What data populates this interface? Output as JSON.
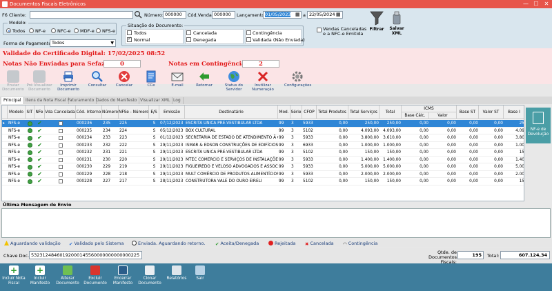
{
  "window": {
    "title": "Documentos Fiscais Eletrônicos",
    "minimize": "—",
    "maximize": "☐",
    "close": "✕"
  },
  "filters": {
    "f6_label": "F6",
    "cliente_label": "Cliente:",
    "cliente_value": "",
    "numero_label": "Número:",
    "numero_value": "000000",
    "cod_venda_label": "Cód.Venda:",
    "cod_venda_value": "000000",
    "lancamento_label": "Lançamento:",
    "date_from": "01/05/2023",
    "date_sep": "a",
    "date_to": "22/05/2024",
    "modelo_title": "Modelo:",
    "modelo_options": [
      "Todos",
      "NF-e",
      "NFC-e",
      "MDF-e",
      "NFS-e"
    ],
    "modelo_selected": "Todos",
    "forma_pagamento_label": "Forma de Pagamento:",
    "forma_pagamento_value": "Todos",
    "situacao_title": "Situação do Documento:",
    "situacao_options": [
      "Todos",
      "Normal",
      "Cancelada",
      "Denegada",
      "Contingência",
      "Validada (Não Enviada)"
    ],
    "vendas_canceladas_label": "Vendas Canceladas e a NFC-e Emitida",
    "filtrar_label": "Filtrar",
    "salvar_xml_label": "Salvar XML"
  },
  "status": {
    "validade_label": "Validade do Certificado Digital: 17/02/2025 08:52",
    "nao_enviadas_label": "Notas Não Enviadas para Sefaz:",
    "nao_enviadas_count": "0",
    "contingencia_label": "Notas em Contingência:",
    "contingencia_count": "2"
  },
  "toolbar": [
    {
      "label": "Enviar Documento",
      "icon": "send-document-icon",
      "disabled": true
    },
    {
      "label": "Pré Visualizar Documento",
      "icon": "preview-document-icon",
      "disabled": true
    },
    {
      "label": "Imprimir Documento",
      "icon": "printer-icon",
      "disabled": false
    },
    {
      "label": "Consultar",
      "icon": "magnifier-icon",
      "disabled": false
    },
    {
      "label": "Cancelar",
      "icon": "cancel-icon",
      "disabled": false
    },
    {
      "label": "CCe",
      "icon": "correction-letter-icon",
      "disabled": false
    },
    {
      "label": "E-mail",
      "icon": "email-icon",
      "disabled": false
    },
    {
      "label": "Retornar",
      "icon": "return-icon",
      "disabled": false
    },
    {
      "label": "Status do Servidor",
      "icon": "globe-icon",
      "disabled": false
    },
    {
      "label": "Inutilizar Numeração",
      "icon": "disable-numbering-icon",
      "disabled": false
    },
    {
      "label": "Configurações",
      "icon": "gear-icon",
      "disabled": false
    }
  ],
  "tabs": [
    "Principal",
    "Itens da Nota Fiscal",
    "Faturamento",
    "Dados do Manifesto",
    "Visualizar XML",
    "Log"
  ],
  "table": {
    "icms_group": "ICMS",
    "columns": [
      "Modelo",
      "SIT",
      "NFe",
      "Vda Cancelada",
      "Cód. Interno",
      "Número",
      "NFSe - Número",
      "E/S",
      "Emissão",
      "Destinatário",
      "Mod.",
      "Série",
      "CFOP",
      "Total Produtos",
      "Total Serviços",
      "Total",
      "Base Cálc.",
      "Valor",
      "Base ST",
      "Valor ST",
      "Base I"
    ],
    "rows": [
      [
        "NFS-e",
        "000236",
        "235",
        "225",
        "S",
        "07/12/2023",
        "ESCRITA UNICA PRE-VESTIBULAR LTDA",
        "99",
        "3",
        "5933",
        "0,00",
        "250,00",
        "250,00",
        "0,00",
        "0,00",
        "0,00",
        "0,00",
        "25"
      ],
      [
        "NFS-e",
        "000235",
        "234",
        "224",
        "S",
        "05/12/2023",
        "BOX CULTURAL",
        "99",
        "3",
        "5102",
        "0,00",
        "4.093,00",
        "4.093,00",
        "0,00",
        "0,00",
        "0,00",
        "0,00",
        "4.09"
      ],
      [
        "NFS-e",
        "000234",
        "233",
        "223",
        "S",
        "01/12/2023",
        "SECRETARIA DE ESTADO DE ATENDIMENTO Ã CIDADANIA",
        "99",
        "3",
        "5933",
        "0,00",
        "3.800,00",
        "3.610,00",
        "0,00",
        "0,00",
        "0,00",
        "0,00",
        "3.80"
      ],
      [
        "NFS-e",
        "000233",
        "232",
        "222",
        "S",
        "29/11/2023",
        "ISMAR & EDSON CONSTRUÇÕES DE EDIFÍCIOS LTDA",
        "99",
        "3",
        "6933",
        "0,00",
        "1.000,00",
        "1.000,00",
        "0,00",
        "0,00",
        "0,00",
        "0,00",
        "1.00"
      ],
      [
        "NFS-e",
        "000232",
        "231",
        "221",
        "S",
        "29/11/2023",
        "ESCRITA UNICA PRE-VESTIBULAR LTDA",
        "99",
        "3",
        "5102",
        "0,00",
        "150,00",
        "150,00",
        "0,00",
        "0,00",
        "0,00",
        "0,00",
        "15"
      ],
      [
        "NFS-e",
        "000231",
        "230",
        "220",
        "S",
        "29/11/2023",
        "MTEC COMERCIO E SERVIÇOS DE INSTALAÇÕES LTDA",
        "99",
        "3",
        "5933",
        "0,00",
        "1.400,00",
        "1.400,00",
        "0,00",
        "0,00",
        "0,00",
        "0,00",
        "1.40"
      ],
      [
        "NFS-e",
        "000230",
        "229",
        "219",
        "S",
        "29/11/2023",
        "FIGUEIREDO E VELOSO ADVOGADOS E ASSOCIADOS",
        "99",
        "3",
        "5933",
        "0,00",
        "5.000,00",
        "5.000,00",
        "0,00",
        "0,00",
        "0,00",
        "0,00",
        "5.00"
      ],
      [
        "NFS-e",
        "000229",
        "228",
        "218",
        "S",
        "29/11/2023",
        "MULT COMÉRCIO DE PRODUTOS ALIMENTÍCIOS LTDA",
        "99",
        "3",
        "5933",
        "0,00",
        "2.000,00",
        "2.000,00",
        "0,00",
        "0,00",
        "0,00",
        "0,00",
        "2.00"
      ],
      [
        "NFS-e",
        "000228",
        "227",
        "217",
        "S",
        "28/11/2023",
        "CONSTRUTORA VALE DO OURO EIRELI",
        "99",
        "3",
        "5102",
        "0,00",
        "150,00",
        "150,00",
        "0,00",
        "0,00",
        "0,00",
        "0,00",
        "15"
      ]
    ]
  },
  "devolucao_label": "NF-e de Devolução",
  "mensagem_title": "Última Mensagem de Envio",
  "mensagem_text": "",
  "legend": [
    {
      "label": "Aguardando validação",
      "icon": "warning-icon",
      "color": "#f2c200"
    },
    {
      "label": "Validado pelo Sistema",
      "icon": "checkmark-blue-icon",
      "color": "#2a6fd6"
    },
    {
      "label": "Enviada. Aguardando retorno.",
      "icon": "info-icon",
      "color": "#333333"
    },
    {
      "label": "Aceita/Denegada",
      "icon": "checkmark-green-icon",
      "color": "#2e9b2e"
    },
    {
      "label": "Rejeitada",
      "icon": "rejected-icon",
      "color": "#e02020"
    },
    {
      "label": "Cancelada",
      "icon": "cancelled-icon",
      "color": "#e02020"
    },
    {
      "label": "Contingência",
      "icon": "wifi-icon",
      "color": "#333333"
    }
  ],
  "footer": {
    "chave_label": "Chave Doc.:",
    "chave_value": "53231248460192000145560000000000000225",
    "qtde_label": "Qtde. de Documentos Fiscais:",
    "qtde_value": "195",
    "total_label": "Total:",
    "total_value": "607.124,34"
  },
  "actions": [
    {
      "label": "Incluir Nota Fiscal",
      "icon": "add-invoice-icon"
    },
    {
      "label": "Incluir Manifesto",
      "icon": "add-manifest-icon"
    },
    {
      "label": "Alterar Documento",
      "icon": "edit-document-icon"
    },
    {
      "label": "Excluir Documento",
      "icon": "trash-icon"
    },
    {
      "label": "Encerrar Manifesto",
      "icon": "close-manifest-icon"
    },
    {
      "label": "Clonar Documento",
      "icon": "clone-document-icon"
    },
    {
      "label": "Relatórios",
      "icon": "reports-icon"
    },
    {
      "label": "Sair",
      "icon": "exit-icon"
    }
  ]
}
